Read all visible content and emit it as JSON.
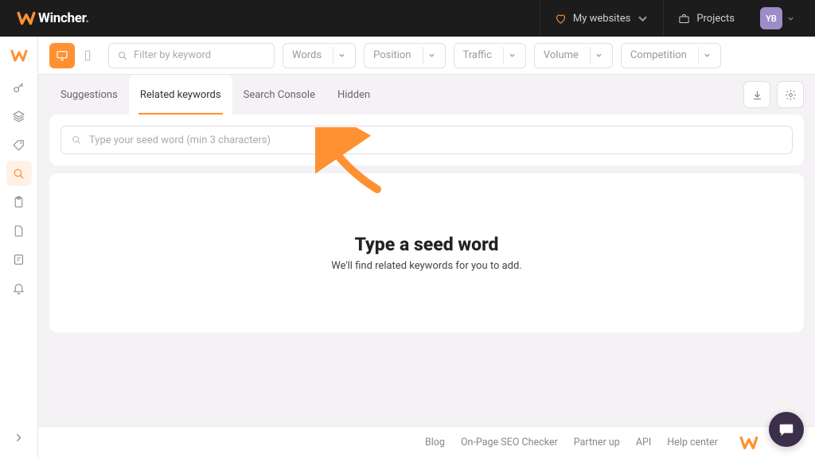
{
  "brand": {
    "name": "Wincher",
    "dot": "."
  },
  "nav": {
    "my_websites": "My websites",
    "projects": "Projects",
    "avatar": "YB"
  },
  "toolbar": {
    "filter_placeholder": "Filter by keyword",
    "dropdowns": {
      "words": "Words",
      "position": "Position",
      "traffic": "Traffic",
      "volume": "Volume",
      "competition": "Competition"
    }
  },
  "tabs": {
    "suggestions": "Suggestions",
    "related": "Related keywords",
    "search_console": "Search Console",
    "hidden": "Hidden"
  },
  "seed": {
    "placeholder": "Type your seed word (min 3 characters)"
  },
  "empty": {
    "title": "Type a seed word",
    "subtitle": "We'll find related keywords for you to add."
  },
  "footer": {
    "blog": "Blog",
    "seo_checker": "On-Page SEO Checker",
    "partner": "Partner up",
    "api": "API",
    "help": "Help center"
  },
  "colors": {
    "accent": "#ff9133",
    "avatar_bg": "#9d8cc9",
    "chat_bg": "#3b2f4a"
  }
}
